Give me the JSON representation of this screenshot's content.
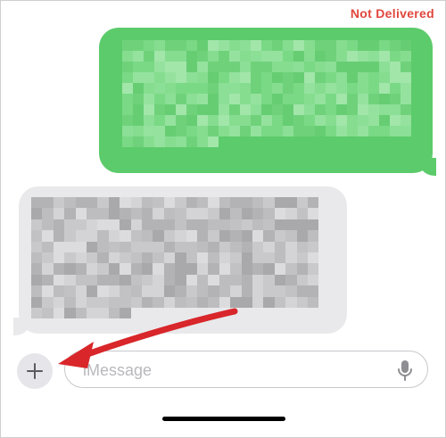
{
  "status": {
    "label": "Not Delivered",
    "color": "#e0463d"
  },
  "messages": [
    {
      "direction": "outgoing",
      "redacted": true,
      "color": "#5ccb6b"
    },
    {
      "direction": "incoming",
      "redacted": true,
      "color": "#e9e9eb"
    }
  ],
  "composer": {
    "add_button_icon": "plus-icon",
    "placeholder": "iMessage",
    "mic_icon": "microphone-icon"
  },
  "annotation": {
    "arrow_icon": "red-arrow-icon",
    "color": "#d8262a"
  }
}
